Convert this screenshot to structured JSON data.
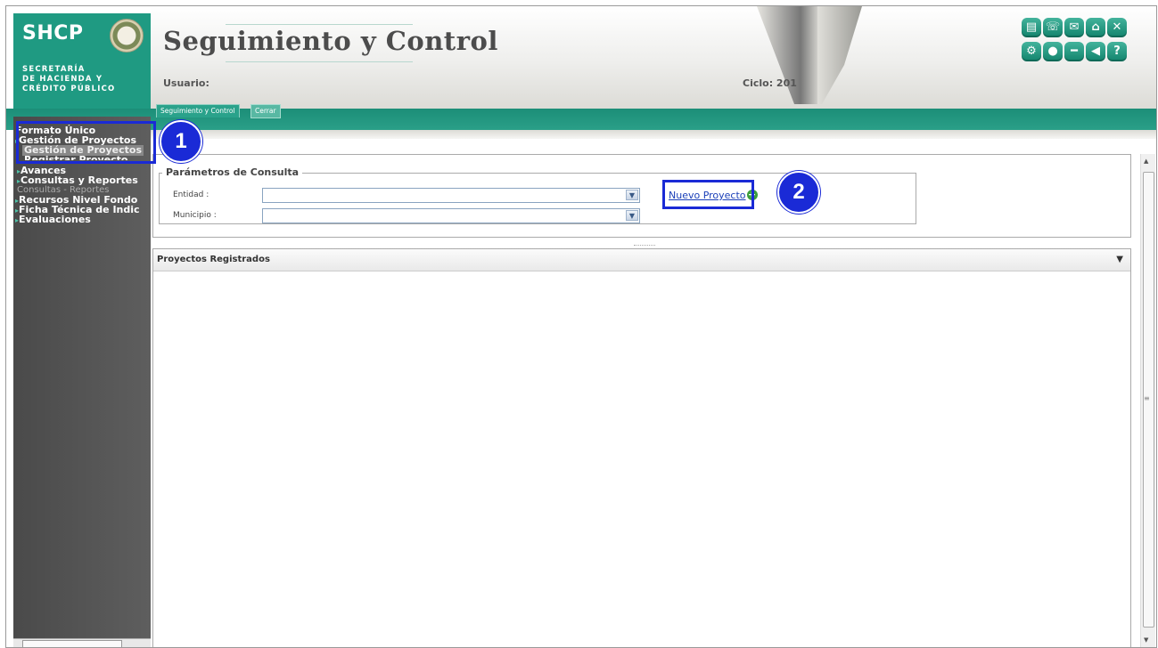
{
  "brand": {
    "acronym": "SHCP",
    "subtitle": "SECRETARÍA\nDE HACIENDA Y\nCRÉDITO PÚBLICO"
  },
  "header": {
    "title": "Seguimiento y Control",
    "usuario_label": "Usuario:",
    "ciclo_label": "Ciclo: 201"
  },
  "toolbar_icons": [
    "printer-icon",
    "phone-icon",
    "mail-icon",
    "home-icon",
    "close-icon",
    "tools-icon",
    "record-icon",
    "minus-icon",
    "back-icon",
    "help-icon"
  ],
  "tabs": {
    "active": "Seguimiento y Control",
    "close": "Cerrar"
  },
  "sidebar": {
    "formato_unico": "Formato Único",
    "gestion_proyectos": "Gestión de Proyectos",
    "gestion_proyectos_sub": "Gestión de Proyectos",
    "registrar_proyecto": "Registrar Proyecto",
    "avances": "Avances",
    "consultas_reportes": "Consultas y Reportes",
    "consultas_reportes_sub": "Consultas - Reportes",
    "recursos": "Recursos Nivel Fondo",
    "ficha": "Ficha Técnica de Indic",
    "evaluaciones": "Evaluaciones"
  },
  "params": {
    "legend": "Parámetros de Consulta",
    "entidad_label": "Entidad :",
    "entidad_value": "",
    "municipio_label": "Municipio :",
    "municipio_value": "",
    "nuevo_proyecto": "Nuevo Proyecto"
  },
  "panel": {
    "title": "Proyectos Registrados"
  },
  "annotations": {
    "one": "1",
    "two": "2",
    "color": "#1a2ad6"
  },
  "colors": {
    "green": "#1f9a82",
    "sidebar": "#555555"
  }
}
